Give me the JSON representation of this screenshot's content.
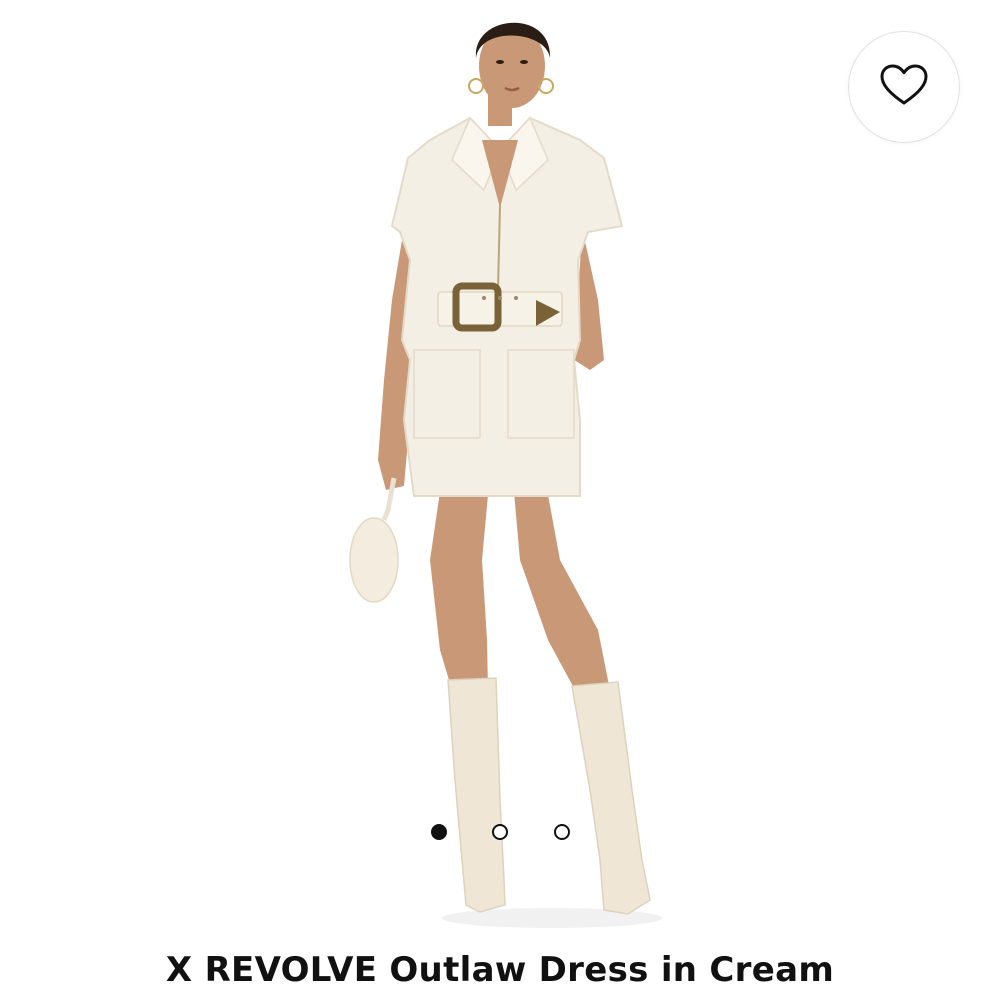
{
  "product": {
    "title": "X REVOLVE Outlaw Dress in Cream",
    "image_alt": "Model wearing cream zip-front mini dress with western belt, cream knee-high boots and sherpa bag"
  },
  "wishlist": {
    "icon": "heart-outline-icon"
  },
  "carousel": {
    "total": 3,
    "active_index": 0
  },
  "colors": {
    "dress": "#f4efe4",
    "boots": "#efe6d6",
    "skin": "#c99877",
    "hair": "#2a1d16",
    "buckle": "#7a6238",
    "dot_active": "#111111"
  }
}
